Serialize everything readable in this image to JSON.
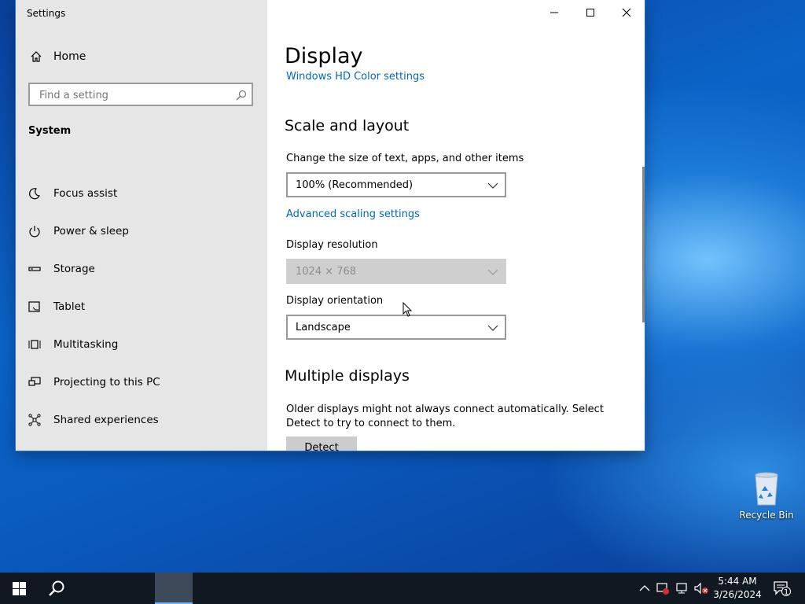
{
  "window": {
    "title": "Settings"
  },
  "sidebar": {
    "home_label": "Home",
    "search_placeholder": "Find a setting",
    "group_title": "System",
    "items": [
      {
        "label": "Focus assist",
        "icon": "moon-icon"
      },
      {
        "label": "Power & sleep",
        "icon": "power-icon"
      },
      {
        "label": "Storage",
        "icon": "storage-icon"
      },
      {
        "label": "Tablet",
        "icon": "tablet-icon"
      },
      {
        "label": "Multitasking",
        "icon": "multitasking-icon"
      },
      {
        "label": "Projecting to this PC",
        "icon": "projecting-icon"
      },
      {
        "label": "Shared experiences",
        "icon": "shared-experiences-icon"
      }
    ]
  },
  "content": {
    "page_title": "Display",
    "hd_color_link": "Windows HD Color settings",
    "scale_heading": "Scale and layout",
    "scale_label": "Change the size of text, apps, and other items",
    "scale_value": "100% (Recommended)",
    "advanced_scaling_link": "Advanced scaling settings",
    "resolution_label": "Display resolution",
    "resolution_value": "1024 × 768",
    "orientation_label": "Display orientation",
    "orientation_value": "Landscape",
    "multiple_heading": "Multiple displays",
    "multiple_text": "Older displays might not always connect automatically. Select Detect to try to connect to them.",
    "detect_label": "Detect"
  },
  "desktop": {
    "recycle_bin_label": "Recycle Bin"
  },
  "taskbar": {
    "time": "5:44 AM",
    "date": "3/26/2024",
    "notification_count": "1"
  }
}
